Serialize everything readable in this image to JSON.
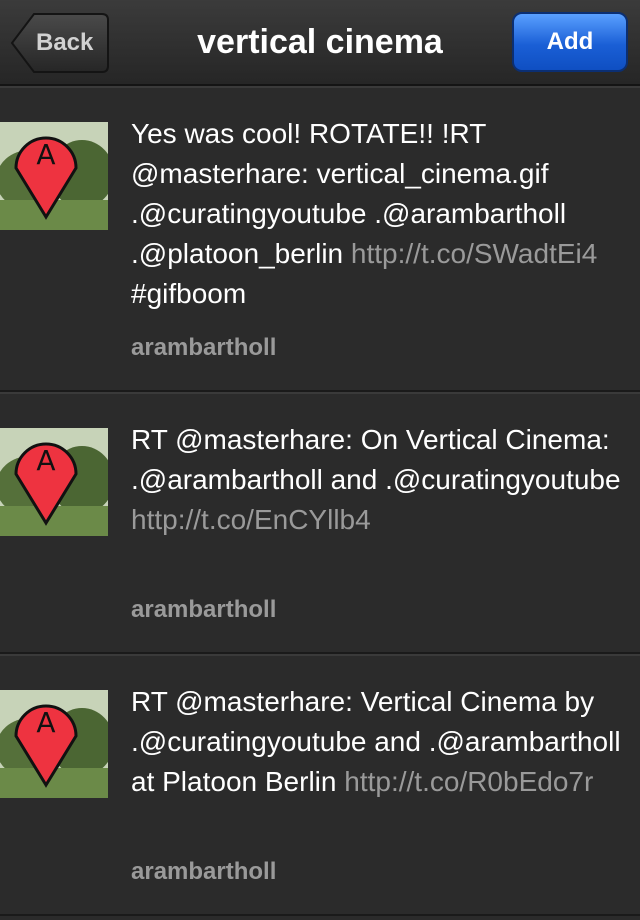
{
  "navbar": {
    "back_label": "Back",
    "title": "vertical cinema",
    "add_label": "Add"
  },
  "avatar_icon": "red-map-pin-with-letter-A-over-trees",
  "avatar_letter": "A",
  "colors": {
    "background": "#2b2b2b",
    "add_button": "#1a5fd6",
    "link_text": "#9a9a9a"
  },
  "tweets": [
    {
      "text": "Yes was cool! ROTATE!! !RT @masterhare: vertical_cinema.gif .@curatingyoutube .@arambartholl .@platoon_berlin ",
      "link": "http://t.co/SWadtEi4",
      "suffix": " #gifboom",
      "author": "arambartholl"
    },
    {
      "text": "RT @masterhare: On Vertical Cinema: .@arambartholl and .@curatingyoutube ",
      "link": "http://t.co/EnCYllb4",
      "suffix": "",
      "author": "arambartholl"
    },
    {
      "text": "RT @masterhare: Vertical Cinema by .@curatingyoutube and .@arambartholl at Platoon Berlin ",
      "link": "http://t.co/R0bEdo7r",
      "suffix": "",
      "author": "arambartholl"
    }
  ]
}
